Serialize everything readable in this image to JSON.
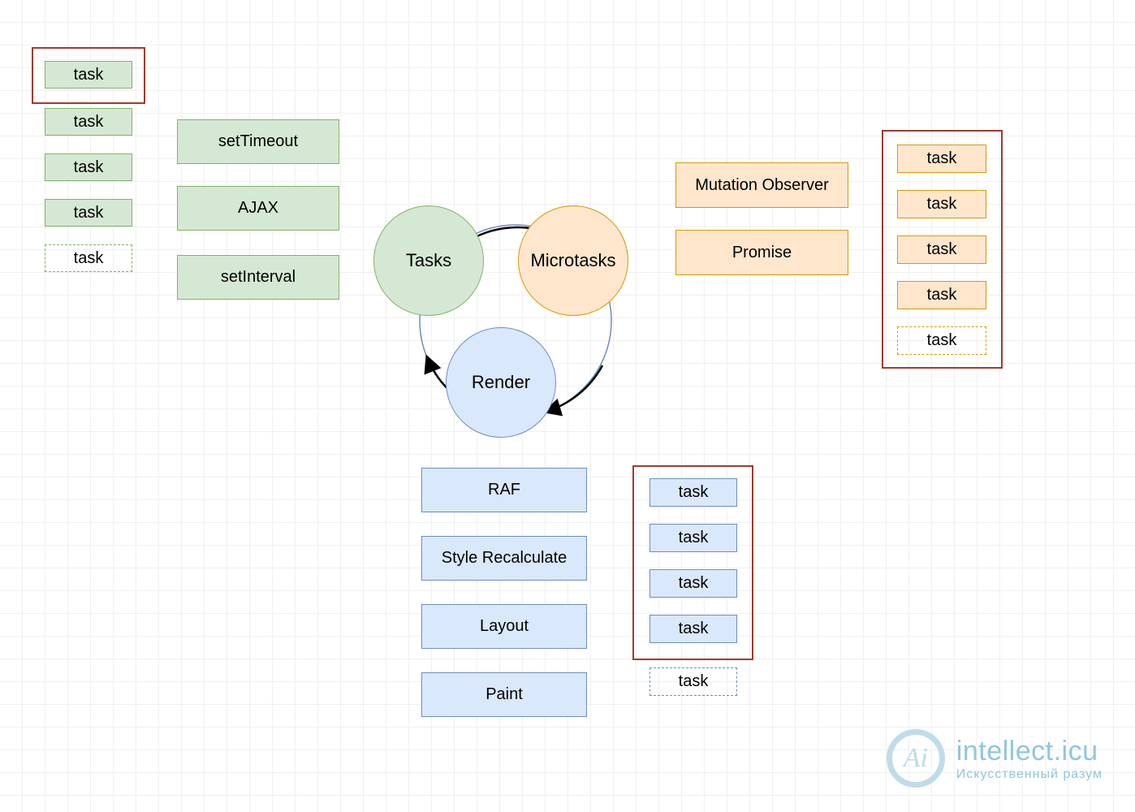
{
  "circles": {
    "tasks": "Tasks",
    "microtasks": "Microtasks",
    "render": "Render"
  },
  "tasks_queue": {
    "items": [
      "task",
      "task",
      "task",
      "task"
    ],
    "pending": "task"
  },
  "tasks_sources": [
    "setTimeout",
    "AJAX",
    "setInterval"
  ],
  "micro_sources": [
    "Mutation Observer",
    "Promise"
  ],
  "micro_queue": {
    "items": [
      "task",
      "task",
      "task",
      "task"
    ],
    "pending": "task"
  },
  "render_steps": [
    "RAF",
    "Style Recalculate",
    "Layout",
    "Paint"
  ],
  "render_queue": {
    "items": [
      "task",
      "task",
      "task",
      "task"
    ],
    "pending": "task"
  },
  "watermark": {
    "title": "intellect.icu",
    "subtitle": "Искусственный разум",
    "mono": "Ai"
  }
}
